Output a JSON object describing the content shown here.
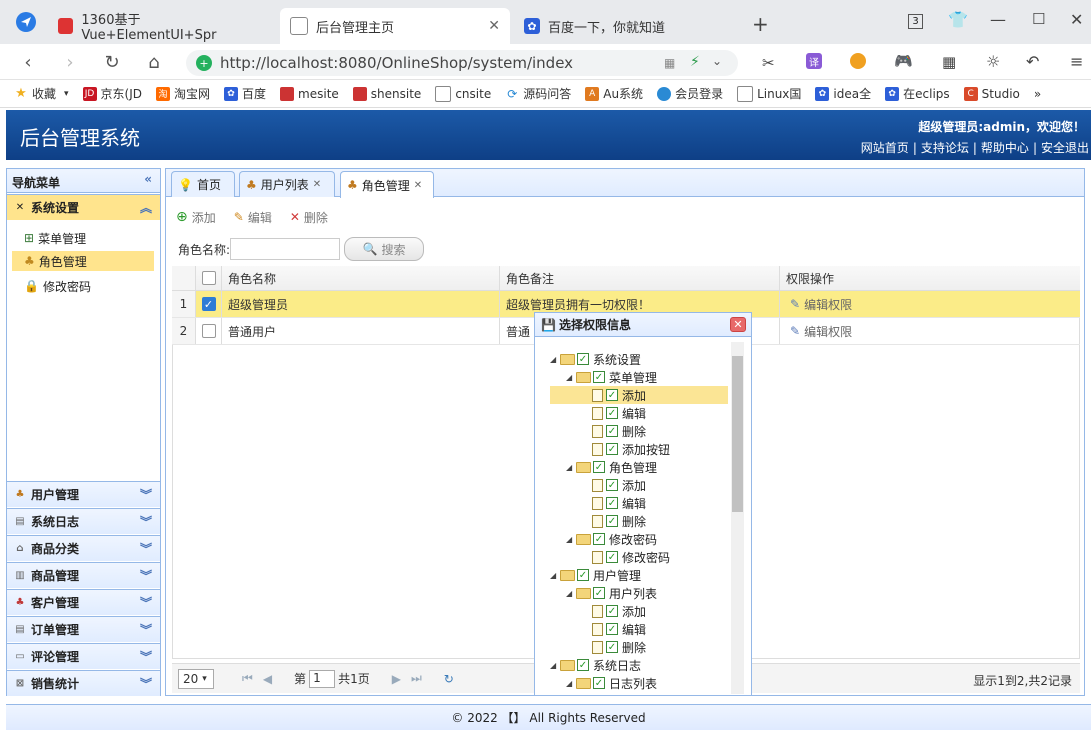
{
  "browser": {
    "tabs": [
      {
        "label": "1360基于Vue+ElementUI+Spr",
        "icon": "red-square"
      },
      {
        "label": "后台管理主页",
        "icon": "page"
      },
      {
        "label": "百度一下，你就知道",
        "icon": "baidu-paw"
      }
    ],
    "tab_count": "3",
    "url": "http://localhost:8080/OnlineShop/system/index",
    "bookmarks": [
      "收藏",
      "京东(JD",
      "淘宝网",
      "百度",
      "mesite",
      "shensite",
      "cnsite",
      "源码问答",
      "Au系统",
      "会员登录",
      "Linux国",
      "idea全",
      "在eclips",
      "Studio"
    ],
    "more": "»"
  },
  "app": {
    "title": "后台管理系统",
    "admin_text": "超级管理员:admin，欢迎您！",
    "top_links": [
      "网站首页",
      "支持论坛",
      "帮助中心",
      "安全退出"
    ]
  },
  "leftnav": {
    "title": "导航菜单",
    "sections": [
      {
        "label": "系统设置",
        "icon": "tools-icon"
      },
      {
        "label": "用户管理",
        "icon": "users-icon"
      },
      {
        "label": "系统日志",
        "icon": "log-icon"
      },
      {
        "label": "商品分类",
        "icon": "category-icon"
      },
      {
        "label": "商品管理",
        "icon": "goods-icon"
      },
      {
        "label": "客户管理",
        "icon": "customer-icon"
      },
      {
        "label": "订单管理",
        "icon": "order-icon"
      },
      {
        "label": "评论管理",
        "icon": "comment-icon"
      },
      {
        "label": "销售统计",
        "icon": "chart-icon"
      }
    ],
    "sub_items": [
      "菜单管理",
      "角色管理",
      "修改密码"
    ]
  },
  "main": {
    "tabs": [
      "首页",
      "用户列表",
      "角色管理"
    ],
    "toolbar": {
      "add": "添加",
      "edit": "编辑",
      "delete": "删除"
    },
    "search_label": "角色名称:",
    "search_button": "搜索",
    "columns": [
      "角色名称",
      "角色备注",
      "权限操作"
    ],
    "rows": [
      {
        "num": "1",
        "name": "超级管理员",
        "remark": "超级管理员拥有一切权限！",
        "action": "编辑权限",
        "checked": true
      },
      {
        "num": "2",
        "name": "普通用户",
        "remark": "普通",
        "action": "编辑权限",
        "checked": false
      }
    ],
    "pager": {
      "page_size": "20",
      "page_prefix": "第",
      "page": "1",
      "total_pages": "共1页",
      "info": "显示1到2,共2记录"
    }
  },
  "dialog": {
    "title": "选择权限信息",
    "close": "✕",
    "tree": [
      {
        "level": 0,
        "label": "系统设置",
        "type": "folder"
      },
      {
        "level": 1,
        "label": "菜单管理",
        "type": "folder"
      },
      {
        "level": 2,
        "label": "添加",
        "type": "file",
        "highlight": true
      },
      {
        "level": 2,
        "label": "编辑",
        "type": "file"
      },
      {
        "level": 2,
        "label": "删除",
        "type": "file"
      },
      {
        "level": 2,
        "label": "添加按钮",
        "type": "file"
      },
      {
        "level": 1,
        "label": "角色管理",
        "type": "folder"
      },
      {
        "level": 2,
        "label": "添加",
        "type": "file"
      },
      {
        "level": 2,
        "label": "编辑",
        "type": "file"
      },
      {
        "level": 2,
        "label": "删除",
        "type": "file"
      },
      {
        "level": 1,
        "label": "修改密码",
        "type": "folder"
      },
      {
        "level": 2,
        "label": "修改密码",
        "type": "file"
      },
      {
        "level": 0,
        "label": "用户管理",
        "type": "folder"
      },
      {
        "level": 1,
        "label": "用户列表",
        "type": "folder"
      },
      {
        "level": 2,
        "label": "添加",
        "type": "file"
      },
      {
        "level": 2,
        "label": "编辑",
        "type": "file"
      },
      {
        "level": 2,
        "label": "删除",
        "type": "file"
      },
      {
        "level": 0,
        "label": "系统日志",
        "type": "folder"
      },
      {
        "level": 1,
        "label": "日志列表",
        "type": "folder"
      }
    ]
  },
  "footer": {
    "text": "© 2022 【】 All Rights Reserved"
  },
  "colors": {
    "header_blue": "#1c5aa8",
    "selection_yellow": "#fbec88",
    "nav_border": "#95b8e7"
  }
}
